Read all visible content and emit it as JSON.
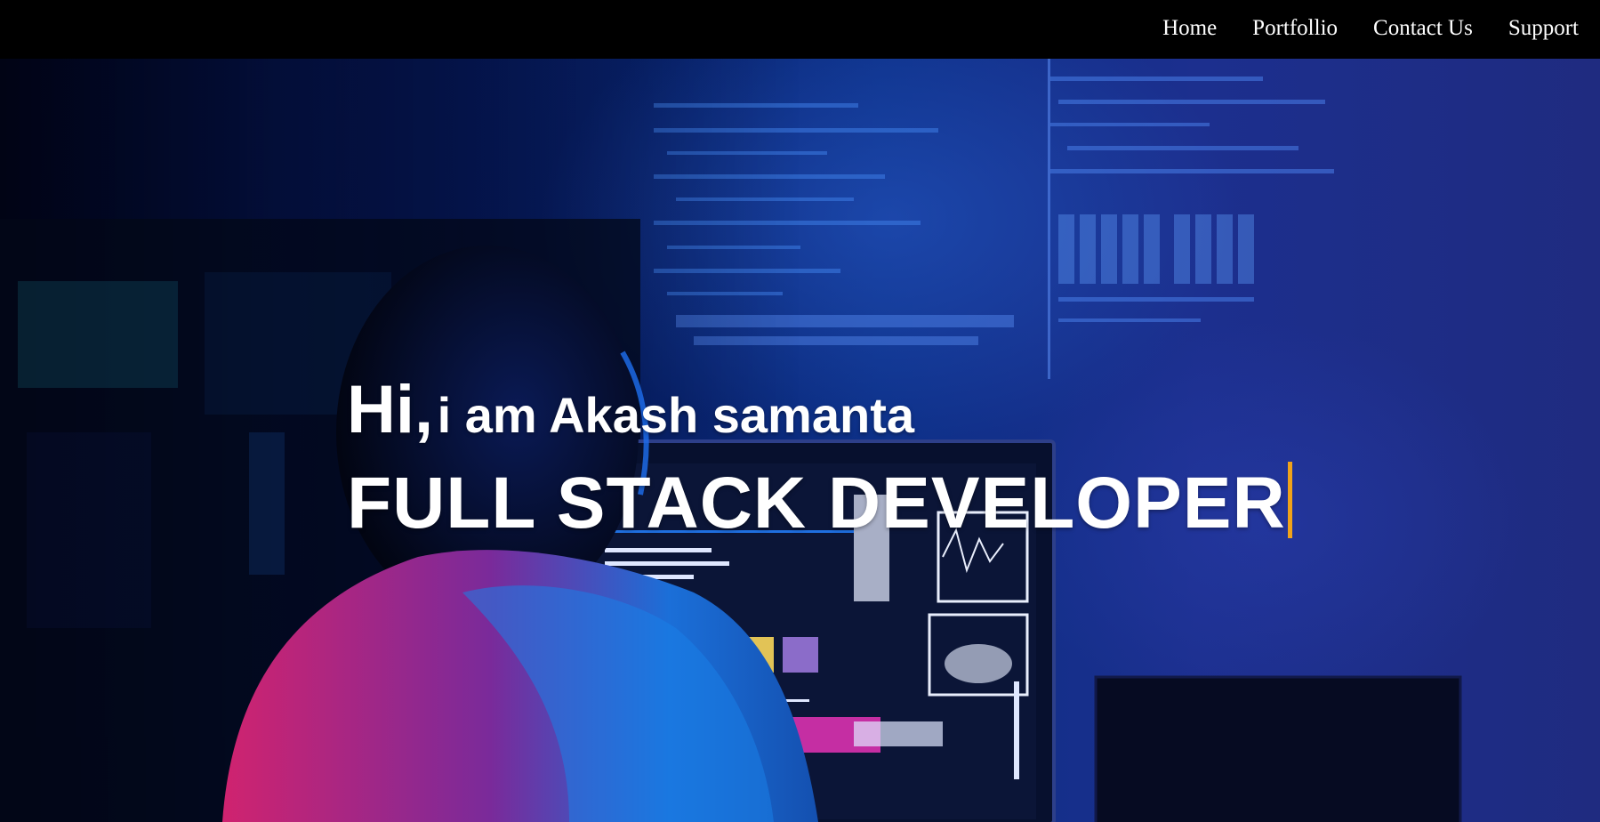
{
  "nav": {
    "items": [
      {
        "label": "Home"
      },
      {
        "label": "Portfollio"
      },
      {
        "label": "Contact Us"
      },
      {
        "label": "Support"
      }
    ]
  },
  "hero": {
    "greeting_hi": "Hi,",
    "greeting_name": "i am Akash samanta",
    "role": "FULL STACK DEVELOPER",
    "caret_color": "#f0a31a",
    "background_image": "developer-at-computer-with-code-screens"
  }
}
